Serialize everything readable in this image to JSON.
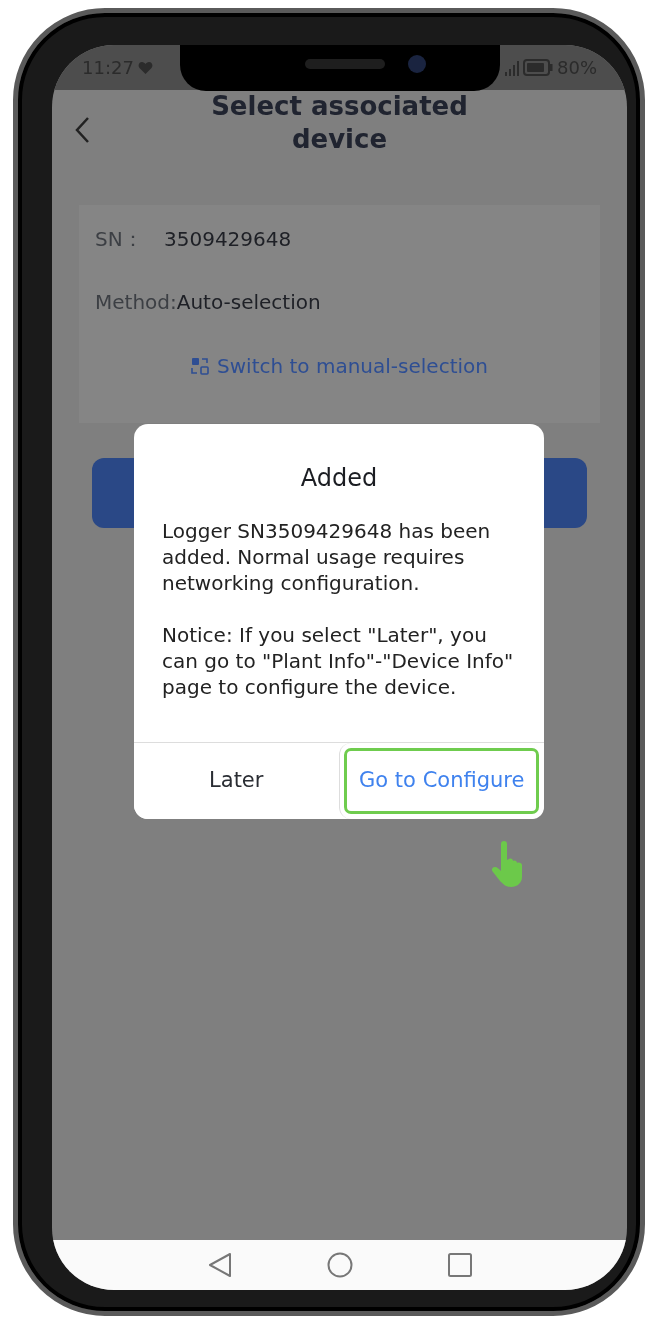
{
  "status_bar": {
    "time": "11:27",
    "battery": "80%"
  },
  "header": {
    "title": "Select associated device"
  },
  "device_card": {
    "sn_label": "SN：",
    "sn_value": "3509429648",
    "method_label": "Method:",
    "method_value": "Auto-selection",
    "switch_link": "Switch to manual-selection"
  },
  "dialog": {
    "title": "Added",
    "message": "Logger SN3509429648 has been added. Normal usage requires networking configuration.",
    "notice": "Notice: If you select \"Later\", you can go to \"Plant Info\"-\"Device Info\" page to configure the device.",
    "buttons": [
      {
        "label": "Later",
        "kind": "secondary",
        "highlighted": false
      },
      {
        "label": "Go to Configure",
        "kind": "primary",
        "highlighted": true
      }
    ]
  }
}
